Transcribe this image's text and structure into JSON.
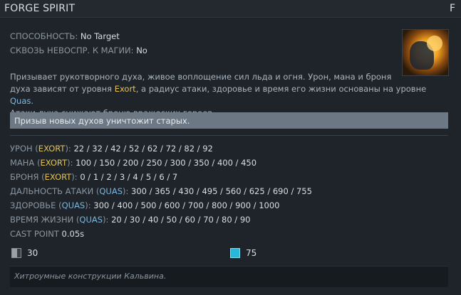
{
  "header": {
    "title": "FORGE SPIRIT",
    "hotkey": "F"
  },
  "ability": {
    "behavior_label": "СПОСОБНОСТЬ:",
    "behavior_value": "No Target",
    "pierce_label": "СКВОЗЬ НЕВОСПР. К МАГИИ:",
    "pierce_value": "No"
  },
  "description": {
    "p1": "Призывает рукотворного духа, живое воплощение сил льда и огня. Урон, мана и броня",
    "p2a": "духа зависят от уровня ",
    "p2b": "Exort",
    "p2c": ", а радиус атаки, здоровье и время его жизни основаны на уровне ",
    "p2d": "Quas",
    "p2e": ".",
    "p3": "Атаки духа снижают броню вражеских героев."
  },
  "note": "Призыв новых духов уничтожит старых.",
  "stats": [
    {
      "label": "УРОН (",
      "tag": "EXORT",
      "tail": "): ",
      "values": "22 / 32 / 42 / 52 / 62 / 72 / 82 / 92"
    },
    {
      "label": "МАНА (",
      "tag": "EXORT",
      "tail": "): ",
      "values": "100 / 150 / 200 / 250 / 300 / 350 / 400 / 450"
    },
    {
      "label": "БРОНЯ (",
      "tag": "EXORT",
      "tail": "): ",
      "values": "0 / 1 / 2 / 3 / 4 / 5 / 6 / 7"
    },
    {
      "label": "ДАЛЬНОСТЬ АТАКИ (",
      "tag": "QUAS",
      "tail": "): ",
      "values": "300 / 365 / 430 / 495 / 560 / 625 / 690 / 755"
    },
    {
      "label": "ЗДОРОВЬЕ (",
      "tag": "QUAS",
      "tail": "): ",
      "values": "300 / 400 / 500 / 600 / 700 / 800 / 900 / 1000"
    },
    {
      "label": "ВРЕМЯ ЖИЗНИ (",
      "tag": "QUAS",
      "tail": "): ",
      "values": "20 / 30 / 40 / 50 / 60 / 70 / 80 / 90"
    }
  ],
  "cast_point": {
    "label": "CAST POINT",
    "value": "0.05s"
  },
  "costs": {
    "cooldown": "30",
    "mana": "75"
  },
  "lore": "Хитроумные конструкции Кальвина.",
  "colors": {
    "exort": "#e2c15a",
    "quas": "#7fb8e0",
    "mana": "#28b8d8"
  },
  "icons": {
    "ability": "forge-spirit-icon",
    "cooldown": "cooldown-icon",
    "mana": "mana-icon"
  }
}
